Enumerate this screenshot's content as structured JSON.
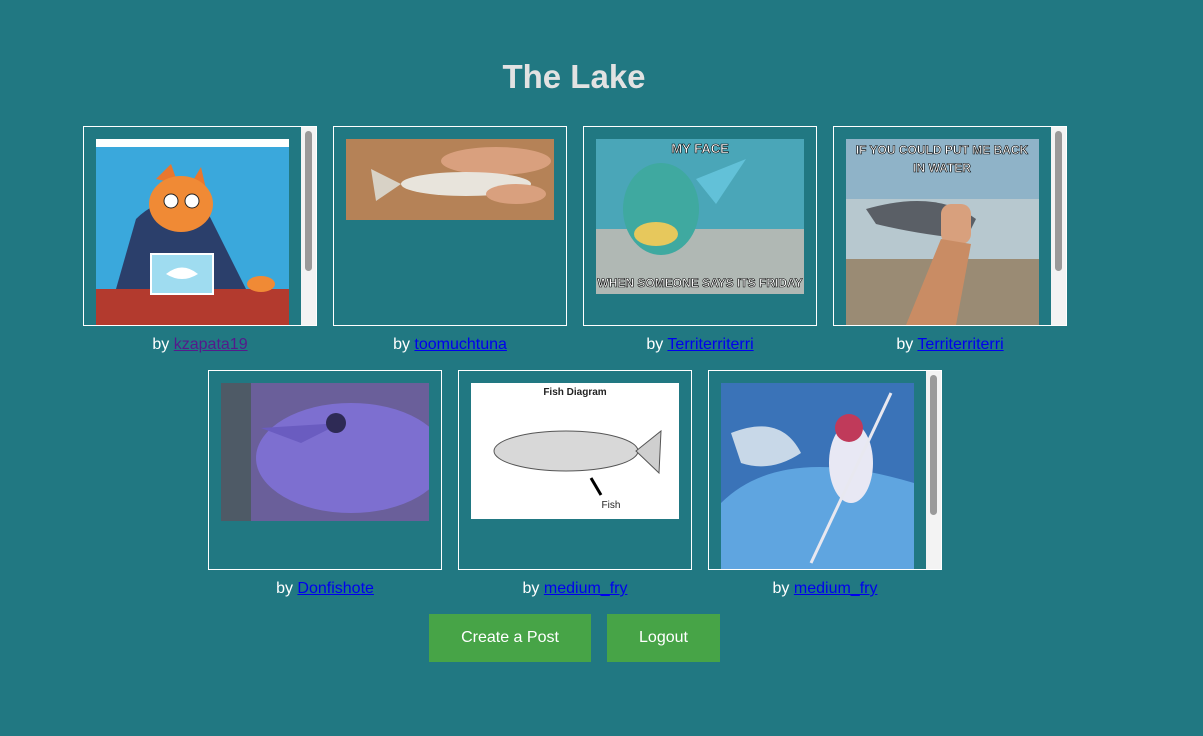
{
  "page": {
    "title": "The Lake"
  },
  "posts": [
    {
      "by": "by",
      "author": "kzapata19",
      "image": "cat-office-worker-image"
    },
    {
      "by": "by",
      "author": "toomuchtuna",
      "image": "fish-in-hand-image"
    },
    {
      "by": "by",
      "author": "Territerriterri",
      "image": "parrotfish-meme-image",
      "meme_top": "MY FACE",
      "meme_bottom": "WHEN SOMEONE SAYS ITS FRIDAY"
    },
    {
      "by": "by",
      "author": "Territerriterri",
      "image": "shark-in-hand-meme-image",
      "meme_top": "IF YOU COULD PUT ME BACK",
      "meme_top2": "IN WATER"
    },
    {
      "by": "by",
      "author": "Donfishote",
      "image": "unicornfish-image"
    },
    {
      "by": "by",
      "author": "medium_fry",
      "image": "fish-diagram-image",
      "diagram_title": "Fish Diagram",
      "diagram_label": "Fish"
    },
    {
      "by": "by",
      "author": "medium_fry",
      "image": "shark-warrior-art-image"
    }
  ],
  "actions": {
    "create_post": "Create a Post",
    "logout": "Logout"
  },
  "colors": {
    "background": "#217882",
    "button": "#47a447",
    "title": "#e2e2e2",
    "link": "#0000ee",
    "visited_link": "#551a8b"
  }
}
